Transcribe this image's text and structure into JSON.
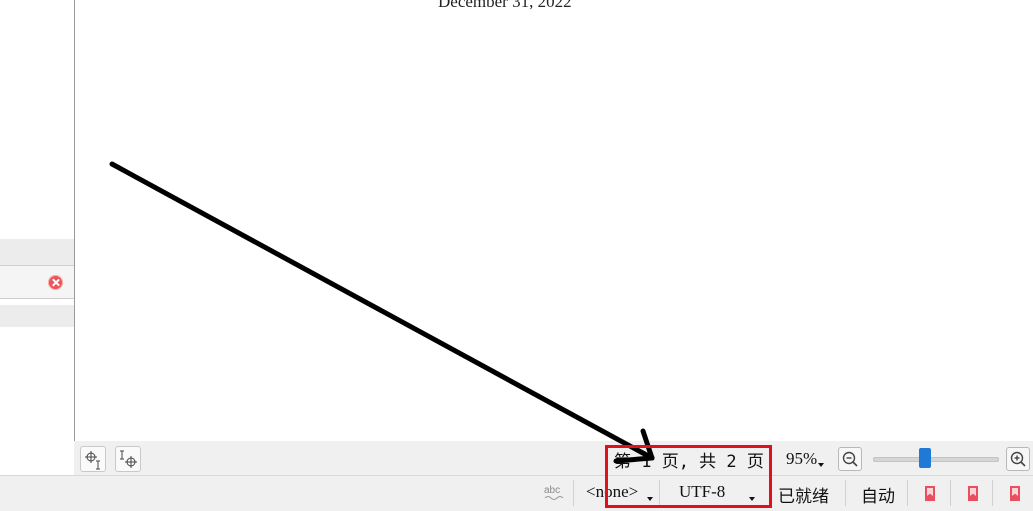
{
  "document": {
    "date_line": "December 31, 2022"
  },
  "status_bar": {
    "page_info": "第 1 页, 共 2 页",
    "zoom": "95%",
    "zoom_percent": 95,
    "paragraph_style": "<none>",
    "encoding": "UTF-8",
    "ready_status": "已就绪",
    "mode": "自动"
  },
  "annotation": {
    "highlight_color": "#e0101e",
    "arrow_color": "#000000"
  },
  "accent_color": "#1f7ad6"
}
